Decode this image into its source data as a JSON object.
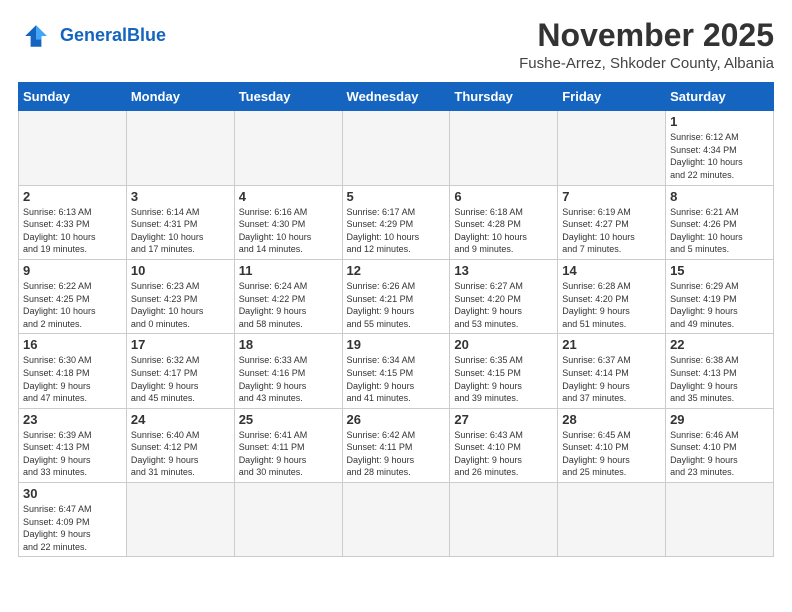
{
  "header": {
    "logo_general": "General",
    "logo_blue": "Blue",
    "title": "November 2025",
    "subtitle": "Fushe-Arrez, Shkoder County, Albania"
  },
  "weekdays": [
    "Sunday",
    "Monday",
    "Tuesday",
    "Wednesday",
    "Thursday",
    "Friday",
    "Saturday"
  ],
  "weeks": [
    [
      {
        "day": "",
        "info": ""
      },
      {
        "day": "",
        "info": ""
      },
      {
        "day": "",
        "info": ""
      },
      {
        "day": "",
        "info": ""
      },
      {
        "day": "",
        "info": ""
      },
      {
        "day": "",
        "info": ""
      },
      {
        "day": "1",
        "info": "Sunrise: 6:12 AM\nSunset: 4:34 PM\nDaylight: 10 hours\nand 22 minutes."
      }
    ],
    [
      {
        "day": "2",
        "info": "Sunrise: 6:13 AM\nSunset: 4:33 PM\nDaylight: 10 hours\nand 19 minutes."
      },
      {
        "day": "3",
        "info": "Sunrise: 6:14 AM\nSunset: 4:31 PM\nDaylight: 10 hours\nand 17 minutes."
      },
      {
        "day": "4",
        "info": "Sunrise: 6:16 AM\nSunset: 4:30 PM\nDaylight: 10 hours\nand 14 minutes."
      },
      {
        "day": "5",
        "info": "Sunrise: 6:17 AM\nSunset: 4:29 PM\nDaylight: 10 hours\nand 12 minutes."
      },
      {
        "day": "6",
        "info": "Sunrise: 6:18 AM\nSunset: 4:28 PM\nDaylight: 10 hours\nand 9 minutes."
      },
      {
        "day": "7",
        "info": "Sunrise: 6:19 AM\nSunset: 4:27 PM\nDaylight: 10 hours\nand 7 minutes."
      },
      {
        "day": "8",
        "info": "Sunrise: 6:21 AM\nSunset: 4:26 PM\nDaylight: 10 hours\nand 5 minutes."
      }
    ],
    [
      {
        "day": "9",
        "info": "Sunrise: 6:22 AM\nSunset: 4:25 PM\nDaylight: 10 hours\nand 2 minutes."
      },
      {
        "day": "10",
        "info": "Sunrise: 6:23 AM\nSunset: 4:23 PM\nDaylight: 10 hours\nand 0 minutes."
      },
      {
        "day": "11",
        "info": "Sunrise: 6:24 AM\nSunset: 4:22 PM\nDaylight: 9 hours\nand 58 minutes."
      },
      {
        "day": "12",
        "info": "Sunrise: 6:26 AM\nSunset: 4:21 PM\nDaylight: 9 hours\nand 55 minutes."
      },
      {
        "day": "13",
        "info": "Sunrise: 6:27 AM\nSunset: 4:20 PM\nDaylight: 9 hours\nand 53 minutes."
      },
      {
        "day": "14",
        "info": "Sunrise: 6:28 AM\nSunset: 4:20 PM\nDaylight: 9 hours\nand 51 minutes."
      },
      {
        "day": "15",
        "info": "Sunrise: 6:29 AM\nSunset: 4:19 PM\nDaylight: 9 hours\nand 49 minutes."
      }
    ],
    [
      {
        "day": "16",
        "info": "Sunrise: 6:30 AM\nSunset: 4:18 PM\nDaylight: 9 hours\nand 47 minutes."
      },
      {
        "day": "17",
        "info": "Sunrise: 6:32 AM\nSunset: 4:17 PM\nDaylight: 9 hours\nand 45 minutes."
      },
      {
        "day": "18",
        "info": "Sunrise: 6:33 AM\nSunset: 4:16 PM\nDaylight: 9 hours\nand 43 minutes."
      },
      {
        "day": "19",
        "info": "Sunrise: 6:34 AM\nSunset: 4:15 PM\nDaylight: 9 hours\nand 41 minutes."
      },
      {
        "day": "20",
        "info": "Sunrise: 6:35 AM\nSunset: 4:15 PM\nDaylight: 9 hours\nand 39 minutes."
      },
      {
        "day": "21",
        "info": "Sunrise: 6:37 AM\nSunset: 4:14 PM\nDaylight: 9 hours\nand 37 minutes."
      },
      {
        "day": "22",
        "info": "Sunrise: 6:38 AM\nSunset: 4:13 PM\nDaylight: 9 hours\nand 35 minutes."
      }
    ],
    [
      {
        "day": "23",
        "info": "Sunrise: 6:39 AM\nSunset: 4:13 PM\nDaylight: 9 hours\nand 33 minutes."
      },
      {
        "day": "24",
        "info": "Sunrise: 6:40 AM\nSunset: 4:12 PM\nDaylight: 9 hours\nand 31 minutes."
      },
      {
        "day": "25",
        "info": "Sunrise: 6:41 AM\nSunset: 4:11 PM\nDaylight: 9 hours\nand 30 minutes."
      },
      {
        "day": "26",
        "info": "Sunrise: 6:42 AM\nSunset: 4:11 PM\nDaylight: 9 hours\nand 28 minutes."
      },
      {
        "day": "27",
        "info": "Sunrise: 6:43 AM\nSunset: 4:10 PM\nDaylight: 9 hours\nand 26 minutes."
      },
      {
        "day": "28",
        "info": "Sunrise: 6:45 AM\nSunset: 4:10 PM\nDaylight: 9 hours\nand 25 minutes."
      },
      {
        "day": "29",
        "info": "Sunrise: 6:46 AM\nSunset: 4:10 PM\nDaylight: 9 hours\nand 23 minutes."
      }
    ],
    [
      {
        "day": "30",
        "info": "Sunrise: 6:47 AM\nSunset: 4:09 PM\nDaylight: 9 hours\nand 22 minutes."
      },
      {
        "day": "",
        "info": ""
      },
      {
        "day": "",
        "info": ""
      },
      {
        "day": "",
        "info": ""
      },
      {
        "day": "",
        "info": ""
      },
      {
        "day": "",
        "info": ""
      },
      {
        "day": "",
        "info": ""
      }
    ]
  ]
}
